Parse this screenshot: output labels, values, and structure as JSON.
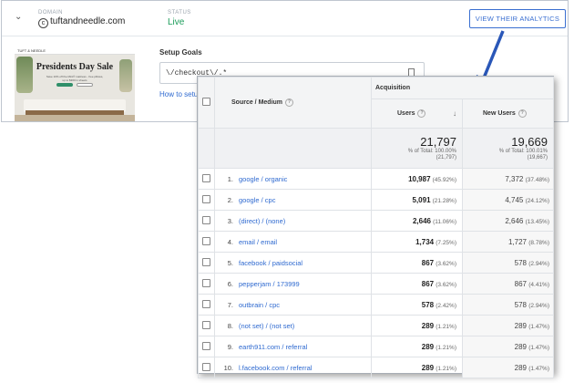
{
  "header": {
    "domain_label": "DOMAIN",
    "domain_value": "tuftandneedle.com",
    "status_label": "STATUS",
    "status_value": "Live",
    "action_button": "VIEW THEIR ANALYTICS"
  },
  "preview": {
    "brand": "TUFT & NEEDLE",
    "headline": "Presidents Day Sale",
    "subtext": "Save 10% off the Mint® mattress - free pillows, up to $300 in sheets"
  },
  "goals": {
    "title": "Setup Goals",
    "input_value": "\\/checkout\\/.*",
    "help_link": "How to setup"
  },
  "table": {
    "group_header": "Acquisition",
    "dimension_header": "Source / Medium",
    "col_users": "Users",
    "col_new_users": "New Users",
    "totals": {
      "users": "21,797",
      "users_sub1": "% of Total: 100.00%",
      "users_sub2": "(21,797)",
      "new_users": "19,669",
      "new_sub1": "% of Total: 100.01%",
      "new_sub2": "(19,667)"
    },
    "rows": [
      {
        "n": "1.",
        "source": "google / organic",
        "users": "10,987",
        "users_pct": "(45.92%)",
        "new": "7,372",
        "new_pct": "(37.48%)"
      },
      {
        "n": "2.",
        "source": "google / cpc",
        "users": "5,091",
        "users_pct": "(21.28%)",
        "new": "4,745",
        "new_pct": "(24.12%)"
      },
      {
        "n": "3.",
        "source": "(direct) / (none)",
        "users": "2,646",
        "users_pct": "(11.06%)",
        "new": "2,646",
        "new_pct": "(13.45%)"
      },
      {
        "n": "4.",
        "source": "email / email",
        "users": "1,734",
        "users_pct": "(7.25%)",
        "new": "1,727",
        "new_pct": "(8.78%)"
      },
      {
        "n": "5.",
        "source": "facebook / paidsocial",
        "users": "867",
        "users_pct": "(3.62%)",
        "new": "578",
        "new_pct": "(2.94%)"
      },
      {
        "n": "6.",
        "source": "pepperjam / 173999",
        "users": "867",
        "users_pct": "(3.62%)",
        "new": "867",
        "new_pct": "(4.41%)"
      },
      {
        "n": "7.",
        "source": "outbrain / cpc",
        "users": "578",
        "users_pct": "(2.42%)",
        "new": "578",
        "new_pct": "(2.94%)"
      },
      {
        "n": "8.",
        "source": "(not set) / (not set)",
        "users": "289",
        "users_pct": "(1.21%)",
        "new": "289",
        "new_pct": "(1.47%)"
      },
      {
        "n": "9.",
        "source": "earth911.com / referral",
        "users": "289",
        "users_pct": "(1.21%)",
        "new": "289",
        "new_pct": "(1.47%)"
      },
      {
        "n": "10.",
        "source": "l.facebook.com / referral",
        "users": "289",
        "users_pct": "(1.21%)",
        "new": "289",
        "new_pct": "(1.47%)"
      }
    ]
  },
  "colors": {
    "accent": "#3a6fd1",
    "status": "#1b9c5a",
    "arrow": "#2a57b8"
  }
}
